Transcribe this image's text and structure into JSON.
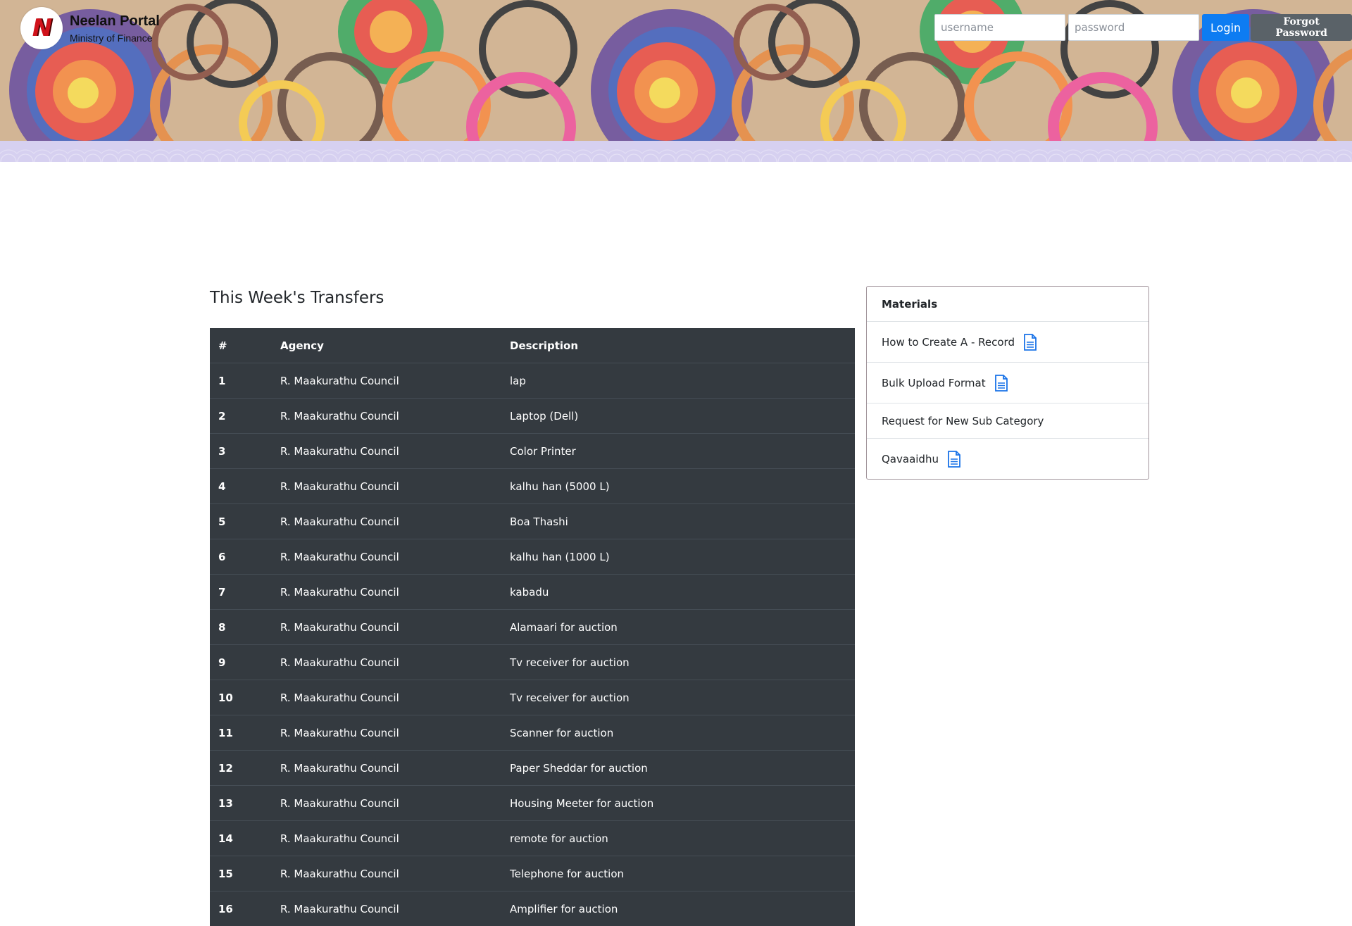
{
  "header": {
    "brand_title": "Neelan Portal",
    "brand_subtitle": "Ministry of Finance",
    "logo_letter": "N",
    "username_placeholder": "username",
    "password_placeholder": "password",
    "login_label": "Login",
    "forgot_label": "Forgot Password"
  },
  "transfers": {
    "title": "This Week's Transfers",
    "columns": [
      "#",
      "Agency",
      "Description"
    ],
    "rows": [
      {
        "num": "1",
        "agency": "R. Maakurathu Council",
        "description": "lap"
      },
      {
        "num": "2",
        "agency": "R. Maakurathu Council",
        "description": "Laptop (Dell)"
      },
      {
        "num": "3",
        "agency": "R. Maakurathu Council",
        "description": "Color Printer"
      },
      {
        "num": "4",
        "agency": "R. Maakurathu Council",
        "description": "kalhu han (5000 L)"
      },
      {
        "num": "5",
        "agency": "R. Maakurathu Council",
        "description": "Boa Thashi"
      },
      {
        "num": "6",
        "agency": "R. Maakurathu Council",
        "description": "kalhu han (1000 L)"
      },
      {
        "num": "7",
        "agency": "R. Maakurathu Council",
        "description": "kabadu"
      },
      {
        "num": "8",
        "agency": "R. Maakurathu Council",
        "description": "Alamaari for auction"
      },
      {
        "num": "9",
        "agency": "R. Maakurathu Council",
        "description": "Tv receiver for auction"
      },
      {
        "num": "10",
        "agency": "R. Maakurathu Council",
        "description": "Tv receiver for auction"
      },
      {
        "num": "11",
        "agency": "R. Maakurathu Council",
        "description": "Scanner for auction"
      },
      {
        "num": "12",
        "agency": "R. Maakurathu Council",
        "description": "Paper Sheddar for auction"
      },
      {
        "num": "13",
        "agency": "R. Maakurathu Council",
        "description": "Housing Meeter for auction"
      },
      {
        "num": "14",
        "agency": "R. Maakurathu Council",
        "description": "remote for auction"
      },
      {
        "num": "15",
        "agency": "R. Maakurathu Council",
        "description": "Telephone for auction"
      },
      {
        "num": "16",
        "agency": "R. Maakurathu Council",
        "description": "Amplifier for auction"
      }
    ]
  },
  "materials": {
    "title": "Materials",
    "items": [
      {
        "label": "How to Create A - Record",
        "icon": "document-icon"
      },
      {
        "label": "Bulk Upload Format",
        "icon": "document-icon"
      },
      {
        "label": "Request for New Sub Category",
        "icon": ""
      },
      {
        "label": "Qavaaidhu",
        "icon": "document-icon"
      }
    ]
  },
  "colors": {
    "table_bg": "#343a40",
    "login_button": "#0d7cf2",
    "forgot_button": "#5a6268",
    "icon_accent": "#1a73e8",
    "pattern_strip": "#d6d0f0"
  }
}
